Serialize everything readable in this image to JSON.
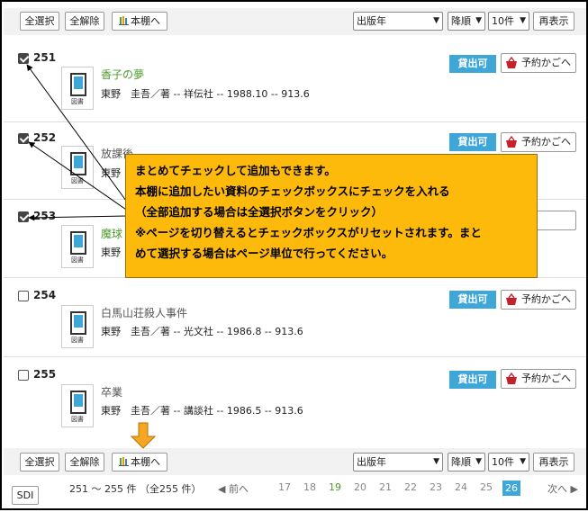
{
  "toolbar": {
    "select_all": "全選択",
    "clear_all": "全解除",
    "to_shelf": "本棚へ",
    "sort_field": "出版年",
    "sort_order": "降順",
    "per_page": "10件",
    "redisplay": "再表示"
  },
  "items": [
    {
      "num": "251",
      "title": "香子の夢",
      "meta": "東野　圭吾／著 -- 祥伝社 -- 1988.10 -- 913.6",
      "status": "貸出可",
      "reserve": "予約かごへ",
      "type_label": "図書",
      "checked": true
    },
    {
      "num": "252",
      "title": "放課後",
      "meta": "東野",
      "status": "貸出可",
      "reserve": "予約かごへ",
      "type_label": "図書",
      "checked": true
    },
    {
      "num": "253",
      "title": "魔球",
      "meta": "東野",
      "status": "",
      "reserve": "",
      "type_label": "図書",
      "checked": true
    },
    {
      "num": "254",
      "title": "白馬山荘殺人事件",
      "meta": "東野　圭吾／著 -- 光文社 -- 1986.8 -- 913.6",
      "status": "貸出可",
      "reserve": "予約かごへ",
      "type_label": "図書",
      "checked": false
    },
    {
      "num": "255",
      "title": "卒業",
      "meta": "東野　圭吾／著 -- 講談社 -- 1986.5 -- 913.6",
      "status": "貸出可",
      "reserve": "予約かごへ",
      "type_label": "図書",
      "checked": false
    }
  ],
  "popup": {
    "line1": "まとめてチェックして追加もできます。",
    "line2": "本棚に追加したい資料のチェックボックスにチェックを入れる",
    "line3": "（全部追加する場合は全選択ボタンをクリック）",
    "line4": "※ページを切り替えるとチェックボックスがリセットされます。まと",
    "line5": "めて選択する場合はページ単位で行ってください。"
  },
  "footer": {
    "sdi": "SDI",
    "range": "251 ～ 255 件 （全255 件）",
    "prev": "◀ 前へ",
    "pages": [
      "17",
      "18",
      "19",
      "20",
      "21",
      "22",
      "23",
      "24",
      "25",
      "26"
    ],
    "current_page": "26",
    "next": "次へ ▶"
  },
  "colors": {
    "accent": "#3fa6d8",
    "popup_bg": "#fdba0a",
    "arrow": "#f5a623",
    "title_green": "#4c9a2a"
  }
}
